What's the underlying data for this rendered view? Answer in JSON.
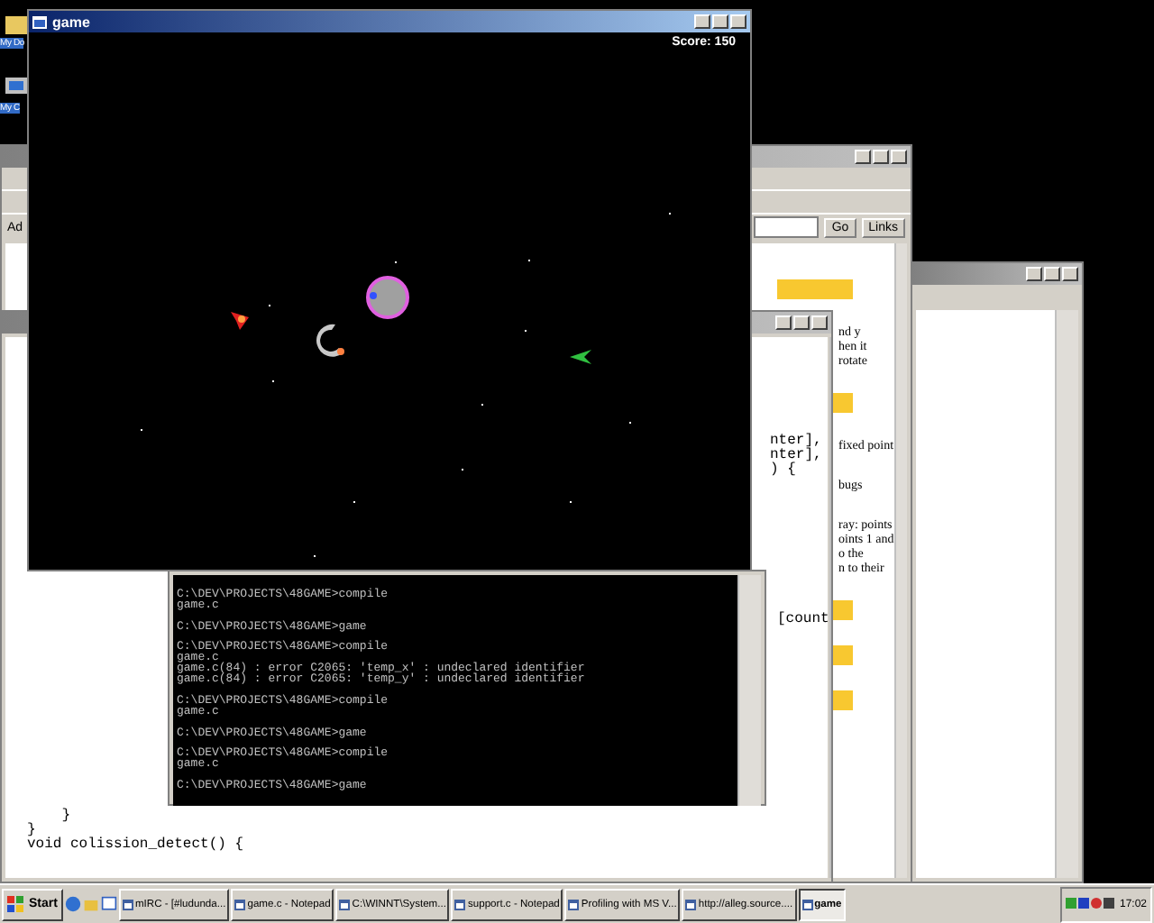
{
  "desktop": {
    "icons": [
      {
        "label": "My Do"
      },
      {
        "label": "My C"
      }
    ]
  },
  "browser_window": {
    "address_label": "Ad",
    "go_button": "Go",
    "links_button": "Links",
    "blocks": [
      {
        "kind": "heading"
      },
      {
        "kind": "text",
        "lines": [
          "nd y",
          "hen it",
          "rotate"
        ]
      },
      {
        "kind": "heading"
      },
      {
        "kind": "text",
        "lines": [
          "fixed point"
        ]
      },
      {
        "kind": "text",
        "lines": [
          "bugs"
        ]
      },
      {
        "kind": "text",
        "lines": [
          "ray: points",
          "oints 1 and",
          "o the",
          "n to their"
        ]
      },
      {
        "kind": "heading"
      },
      {
        "kind": "heading"
      },
      {
        "kind": "heading"
      }
    ]
  },
  "notepad_window": {
    "right_lines": [
      "nter],",
      "nter],",
      ") {"
    ],
    "mid_line": "[count",
    "bottom_lines": [
      "    }",
      "}",
      "void colission_detect() {"
    ]
  },
  "game_window": {
    "title": "game",
    "score": "Score: 150"
  },
  "console_window": {
    "blocks": [
      [
        "C:\\DEV\\PROJECTS\\48GAME>compile",
        "game.c"
      ],
      [
        "C:\\DEV\\PROJECTS\\48GAME>game"
      ],
      [
        "C:\\DEV\\PROJECTS\\48GAME>compile",
        "game.c",
        "game.c(84) : error C2065: 'temp_x' : undeclared identifier",
        "game.c(84) : error C2065: 'temp_y' : undeclared identifier"
      ],
      [
        "C:\\DEV\\PROJECTS\\48GAME>compile",
        "game.c"
      ],
      [
        "C:\\DEV\\PROJECTS\\48GAME>game"
      ],
      [
        "C:\\DEV\\PROJECTS\\48GAME>compile",
        "game.c"
      ],
      [
        "C:\\DEV\\PROJECTS\\48GAME>game"
      ]
    ]
  },
  "taskbar": {
    "start": "Start",
    "tasks": [
      {
        "label": "mIRC - [#ludunda...",
        "selected": false
      },
      {
        "label": "game.c - Notepad",
        "selected": false
      },
      {
        "label": "C:\\WINNT\\System...",
        "selected": false
      },
      {
        "label": "support.c - Notepad",
        "selected": false
      },
      {
        "label": "Profiling with MS V...",
        "selected": false
      },
      {
        "label": "http://alleg.source....",
        "selected": false
      },
      {
        "label": "game",
        "selected": true
      }
    ],
    "clock": "17:02"
  }
}
